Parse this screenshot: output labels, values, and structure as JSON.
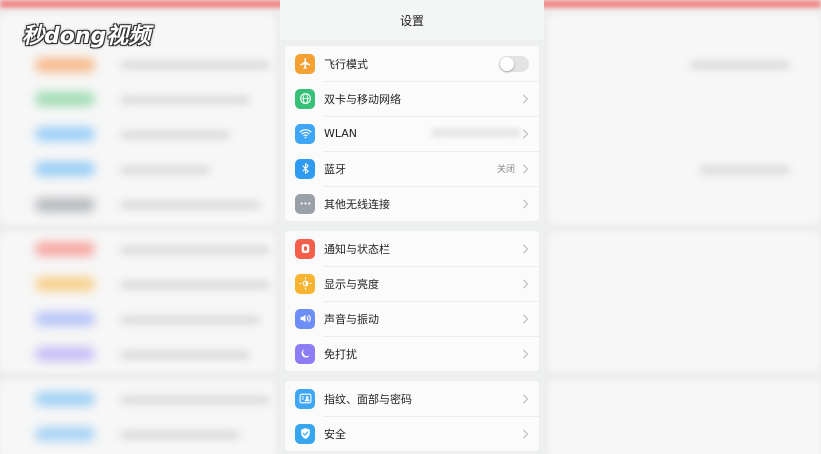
{
  "watermark": {
    "text": "秒dong视频"
  },
  "title": "设置",
  "colors": {
    "airplane": "#f5a033",
    "network": "#37c078",
    "wlan": "#3fa6f5",
    "bluetooth": "#2f9bf0",
    "more": "#9aa0a8",
    "notify": "#f45f4c",
    "display": "#f6b431",
    "sound": "#6d8ef7",
    "dnd": "#8d7cf3",
    "fingerprint": "#3fa6f5",
    "security": "#38a6ef"
  },
  "groups": [
    {
      "items": [
        {
          "id": "airplane",
          "label": "飞行模式",
          "icon": "airplane-icon",
          "control": "toggle",
          "toggle_on": false
        },
        {
          "id": "network",
          "label": "双卡与移动网络",
          "icon": "globe-icon",
          "control": "chevron"
        },
        {
          "id": "wlan",
          "label": "WLAN",
          "icon": "wifi-icon",
          "control": "chevron"
        },
        {
          "id": "bluetooth",
          "label": "蓝牙",
          "icon": "bluetooth-icon",
          "control": "chevron",
          "value": "关闭"
        },
        {
          "id": "more",
          "label": "其他无线连接",
          "icon": "more-dots-icon",
          "control": "chevron"
        }
      ]
    },
    {
      "items": [
        {
          "id": "notify",
          "label": "通知与状态栏",
          "icon": "notification-icon",
          "control": "chevron"
        },
        {
          "id": "display",
          "label": "显示与亮度",
          "icon": "brightness-icon",
          "control": "chevron"
        },
        {
          "id": "sound",
          "label": "声音与振动",
          "icon": "speaker-icon",
          "control": "chevron"
        },
        {
          "id": "dnd",
          "label": "免打扰",
          "icon": "moon-icon",
          "control": "chevron"
        }
      ]
    },
    {
      "items": [
        {
          "id": "fingerprint",
          "label": "指纹、面部与密码",
          "icon": "face-id-icon",
          "control": "chevron"
        },
        {
          "id": "security",
          "label": "安全",
          "icon": "shield-icon",
          "control": "chevron"
        }
      ]
    }
  ]
}
